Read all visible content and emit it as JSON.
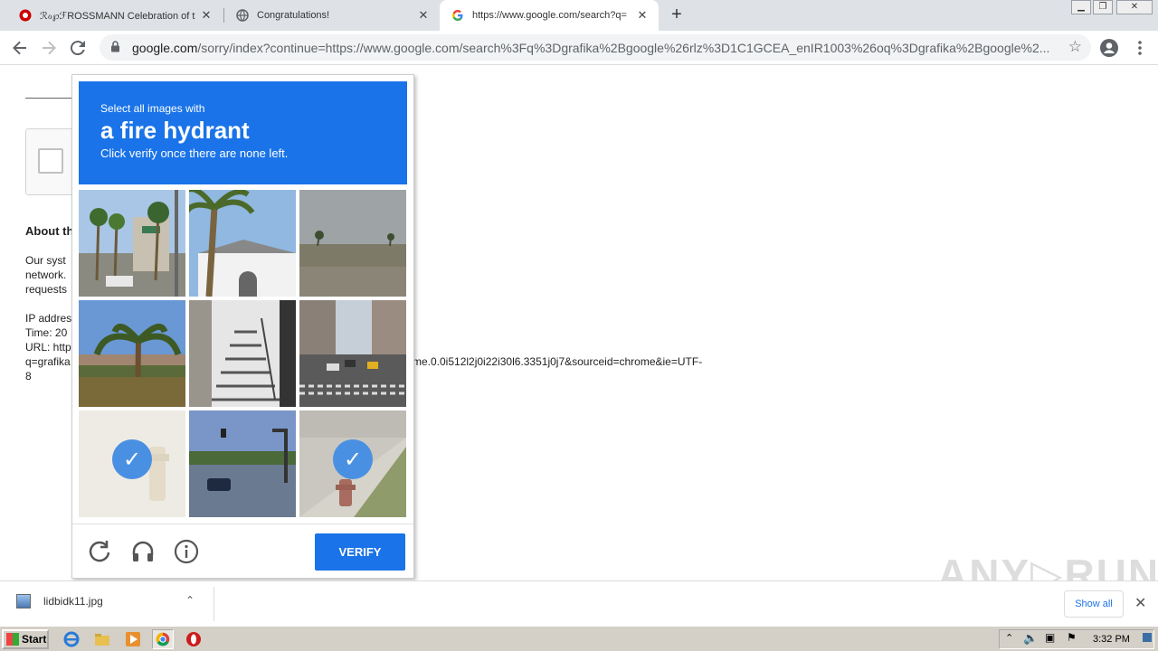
{
  "tabs": [
    {
      "title": "ROSSMANN Celebration of t",
      "prefix": "ℛℴ℘ℱ"
    },
    {
      "title": "Congratulations!"
    },
    {
      "title": "https://www.google.com/search?q="
    }
  ],
  "tab_close": "✕",
  "new_tab": "+",
  "address": {
    "host": "google.com",
    "path": "/sorry/index?continue=https://www.google.com/search%3Fq%3Dgrafika%2Bgoogle%26rlz%3D1C1GCEA_enIR1003%26oq%3Dgrafika%2Bgoogle%2..."
  },
  "page": {
    "about_heading": "About th",
    "para_line1": "Our syst",
    "para_line2": "network.",
    "para_line3": "requests",
    "ip_line": "IP addres",
    "time_line": "Time: 20",
    "url_line": "URL: http",
    "q_line": "q=grafika",
    "url_tail": "me.0.0i512l2j0i22i30l6.3351j0j7&sourceid=chrome&ie=UTF-",
    "eight": "8"
  },
  "captcha": {
    "small_text": "Select all images with",
    "object": "a fire hydrant",
    "instruction": "Click verify once there are none left.",
    "verify_label": "VERIFY",
    "selected_tiles": [
      6,
      8
    ]
  },
  "download": {
    "filename": "lidbidk11.jpg",
    "show_all": "Show all"
  },
  "watermark": "ANY▷RUN",
  "taskbar": {
    "start": "Start",
    "clock": "3:32 PM"
  }
}
